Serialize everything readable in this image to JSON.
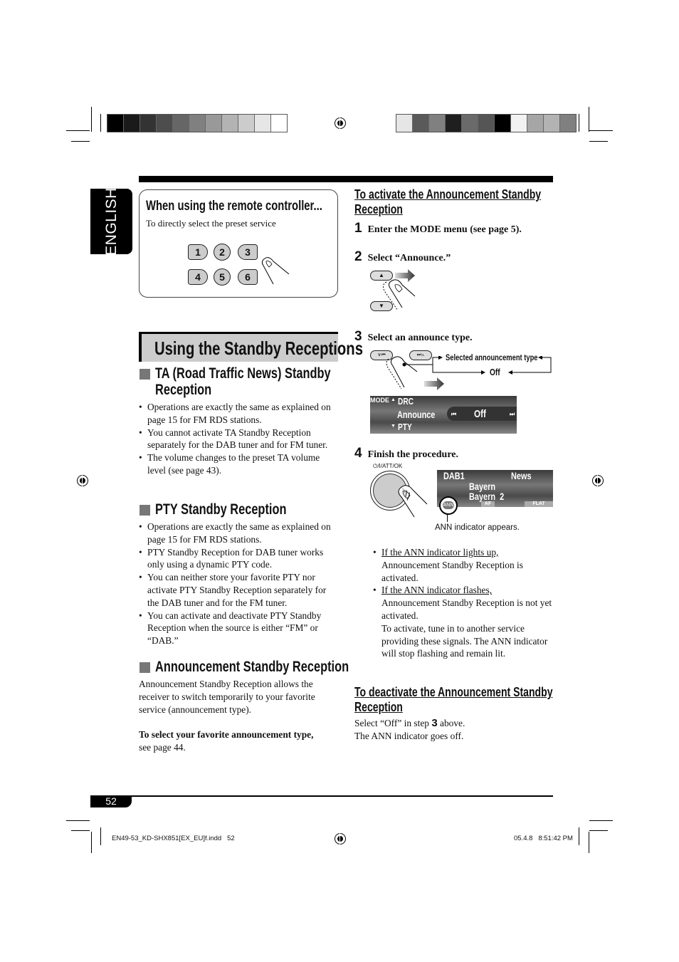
{
  "print_marks": {
    "left_color_bar": [
      "#000000",
      "#1a1a1a",
      "#333333",
      "#4d4d4d",
      "#666666",
      "#808080",
      "#999999",
      "#b3b3b3",
      "#cccccc",
      "#e6e6e6",
      "#ffffff"
    ],
    "right_color_bar": [
      "#e6e6e6",
      "#5a5a5a",
      "#808080",
      "#1f1f1f",
      "#6a6a6a",
      "#555555",
      "#000000",
      "#f2f2f2",
      "#a6a6a6",
      "#b3b3b3",
      "#808080"
    ]
  },
  "language_tab": "ENGLISH",
  "remote_box": {
    "title": "When using the remote controller...",
    "subtitle": "To directly select the preset service",
    "keys": [
      "1",
      "2",
      "3",
      "4",
      "5",
      "6"
    ]
  },
  "section_title": "Using the Standby Receptions",
  "ta": {
    "heading_line1": "TA (Road Traffic News) Standby",
    "heading_line2": "Reception",
    "bullets": [
      "Operations are exactly the same as explained on page 15 for FM RDS stations.",
      "You cannot activate TA Standby Reception separately for the DAB tuner and for FM tuner.",
      "The volume changes to the preset TA volume level (see page 43)."
    ]
  },
  "pty": {
    "heading": "PTY Standby Reception",
    "bullets": [
      "Operations are exactly the same as explained on page 15 for FM RDS stations.",
      "PTY Standby Reception for DAB tuner works only using a dynamic PTY code.",
      "You can neither store your favorite PTY nor activate PTY Standby Reception separately for the DAB tuner and for the FM tuner.",
      "You can activate and deactivate PTY Standby Reception when the source is either “FM” or “DAB.”"
    ]
  },
  "ann": {
    "heading": "Announcement Standby Reception",
    "body": "Announcement Standby Reception allows the receiver to switch temporarily to your favorite service (announcement type).",
    "tip_bold": "To select your favorite announcement type,",
    "tip_rest": "see page 44."
  },
  "activate": {
    "heading_line1": "To activate the Announcement Standby",
    "heading_line2": "Reception",
    "steps": [
      {
        "num": "1",
        "text": "Enter the MODE menu (see page 5)."
      },
      {
        "num": "2",
        "text": "Select “Announce.”"
      },
      {
        "num": "3",
        "text": "Select an announce type."
      },
      {
        "num": "4",
        "text": "Finish the procedure."
      }
    ],
    "step3_diagram": {
      "label_selected": "Selected announcement type",
      "label_off": "Off"
    },
    "mode_lcd": {
      "mode": "MODE",
      "prev_item": "DRC",
      "current_item": "Announce",
      "next_item": "PTY",
      "value": "Off"
    },
    "knob_label": "⏻/I/ATT/OK",
    "dab_lcd": {
      "source": "DAB1",
      "type": "News",
      "ensemble": "Bayern",
      "service": "Bayern  2",
      "ann": "ANN",
      "af": "AF",
      "eq": "FLAT"
    },
    "ann_caption": "ANN indicator appears.",
    "notes": [
      {
        "cond": "If the ANN indicator lights up,",
        "text": "Announcement Standby Reception is activated."
      },
      {
        "cond": "If the ANN indicator flashes,",
        "text": "Announcement Standby Reception is not yet activated.",
        "extra": "To activate, tune in to another service providing these signals. The ANN indicator will stop flashing and remain lit."
      }
    ]
  },
  "deactivate": {
    "heading_line1": "To deactivate the Announcement Standby",
    "heading_line2": "Reception",
    "line1_pre": "Select “Off” in step ",
    "line1_num": "3",
    "line1_post": " above.",
    "line2": "The ANN indicator goes off."
  },
  "footer": {
    "page_number": "52",
    "file_slug": "EN49-53_KD-SHX851[EX_EU]f.indd   52",
    "timestamp": "05.4.8   8:51:42 PM"
  }
}
